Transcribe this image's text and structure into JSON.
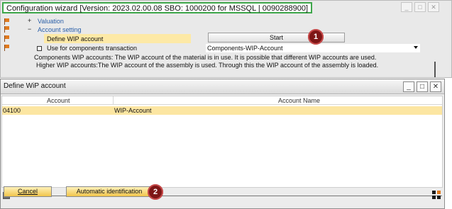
{
  "wizard": {
    "title": "Configuration wizard [Version: 2023.02.00.08 SBO: 1000200 for MSSQL | 0090288900]",
    "window_buttons": [
      "minimize-icon",
      "maximize-icon",
      "close-icon"
    ],
    "tree": {
      "valuation_sign": "+",
      "valuation_label": "Valuation",
      "account_setting_sign": "−",
      "account_setting_label": "Account setting",
      "define_wip_label": "Define WIP account",
      "components_tx_label": "Use for components transaction"
    },
    "start_button": "Start",
    "components_dropdown_value": "Components-WIP-Account",
    "description_line1": "Components WIP accounts: The WIP account of the material is in use. It is possible that different WIP accounts are used.",
    "description_line2": "Higher WIP accounts:The WIP account of the assembly is used. Through this the WIP account of the assembly is loaded."
  },
  "callouts": {
    "one": "1",
    "two": "2"
  },
  "dialog": {
    "title": "Define WiP account",
    "window_buttons": [
      "minimize-icon",
      "maximize-icon",
      "close-icon"
    ],
    "grid": {
      "columns": [
        "Account",
        "Account Name"
      ],
      "rows": [
        {
          "account": "04100",
          "account_name": "WIP-Account"
        }
      ]
    },
    "cancel_button": "Cancel",
    "auto_button": "Automatic identification"
  },
  "colors": {
    "title_highlight_border": "#3ea64a",
    "selected_row": "#fce6a2",
    "button_gold": "#f2c54c",
    "callout": "#7e1616",
    "tree_link": "#2a5fa8"
  }
}
